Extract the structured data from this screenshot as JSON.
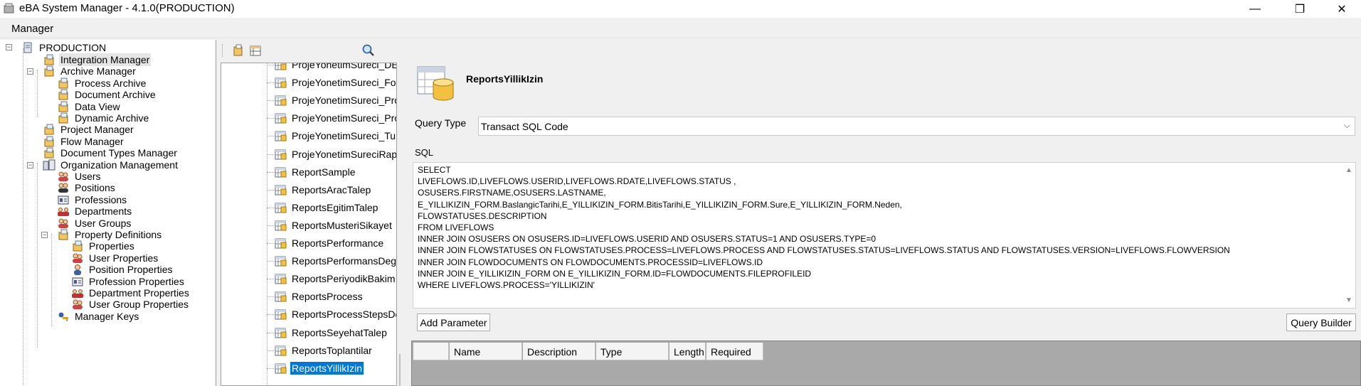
{
  "window": {
    "title": "eBA System Manager - 4.1.0(PRODUCTION)",
    "minimize": "—",
    "restore": "❐",
    "close": "✕"
  },
  "menu": {
    "items": [
      "Manager"
    ]
  },
  "tree": {
    "root": "PRODUCTION",
    "items": [
      {
        "label": "Integration Manager",
        "icon": "box-icon"
      },
      {
        "label": "Archive Manager",
        "icon": "box-icon"
      },
      {
        "label": "Process Archive",
        "icon": "box-icon"
      },
      {
        "label": "Document Archive",
        "icon": "box-icon"
      },
      {
        "label": "Data View",
        "icon": "box-icon"
      },
      {
        "label": "Dynamic Archive",
        "icon": "box-icon"
      },
      {
        "label": "Project Manager",
        "icon": "box-icon"
      },
      {
        "label": "Flow Manager",
        "icon": "box-icon"
      },
      {
        "label": "Document Types Manager",
        "icon": "box-icon"
      },
      {
        "label": "Organization Management",
        "icon": "org-icon"
      },
      {
        "label": "Users",
        "icon": "users-icon"
      },
      {
        "label": "Positions",
        "icon": "positions-icon"
      },
      {
        "label": "Professions",
        "icon": "profession-icon"
      },
      {
        "label": "Departments",
        "icon": "department-icon"
      },
      {
        "label": "User Groups",
        "icon": "users-icon"
      },
      {
        "label": "Property Definitions",
        "icon": "box-icon"
      },
      {
        "label": "Properties",
        "icon": "box-icon"
      },
      {
        "label": "User Properties",
        "icon": "users-icon"
      },
      {
        "label": "Position Properties",
        "icon": "user-icon"
      },
      {
        "label": "Profession Properties",
        "icon": "profession-icon"
      },
      {
        "label": "Department Properties",
        "icon": "department-icon"
      },
      {
        "label": "User Group Properties",
        "icon": "users-icon"
      },
      {
        "label": "Manager Keys",
        "icon": "key-icon"
      }
    ]
  },
  "report_list": {
    "items": [
      "ProjeYonetimSureci_DE",
      "ProjeYonetimSureci_Fo",
      "ProjeYonetimSureci_Pro",
      "ProjeYonetimSureci_Pro",
      "ProjeYonetimSureci_Tu",
      "ProjeYonetimSureciRap",
      "ReportSample",
      "ReportsAracTalep",
      "ReportsEgitimTalep",
      "ReportsMusteriSikayet",
      "ReportsPerformance",
      "ReportsPerformansDeg",
      "ReportsPeriyodikBakim",
      "ReportsProcess",
      "ReportsProcessStepsDe",
      "ReportsSeyehatTalep",
      "ReportsToplantilar",
      "ReportsYillikIzin"
    ],
    "selected": "ReportsYillikIzin"
  },
  "detail": {
    "report_name": "ReportsYillikIzin",
    "query_type_label": "Query Type",
    "query_type_value": "Transact SQL Code",
    "sql_label": "SQL",
    "sql_text": "SELECT\nLIVEFLOWS.ID,LIVEFLOWS.USERID,LIVEFLOWS.RDATE,LIVEFLOWS.STATUS ,\nOSUSERS.FIRSTNAME,OSUSERS.LASTNAME,\nE_YILLIKIZIN_FORM.BaslangicTarihi,E_YILLIKIZIN_FORM.BitisTarihi,E_YILLIKIZIN_FORM.Sure,E_YILLIKIZIN_FORM.Neden,\nFLOWSTATUSES.DESCRIPTION\nFROM LIVEFLOWS\nINNER JOIN OSUSERS ON OSUSERS.ID=LIVEFLOWS.USERID AND OSUSERS.STATUS=1 AND OSUSERS.TYPE=0\nINNER JOIN FLOWSTATUSES ON FLOWSTATUSES.PROCESS=LIVEFLOWS.PROCESS AND FLOWSTATUSES.STATUS=LIVEFLOWS.STATUS AND FLOWSTATUSES.VERSION=LIVEFLOWS.FLOWVERSION\nINNER JOIN FLOWDOCUMENTS ON FLOWDOCUMENTS.PROCESSID=LIVEFLOWS.ID\nINNER JOIN E_YILLIKIZIN_FORM ON E_YILLIKIZIN_FORM.ID=FLOWDOCUMENTS.FILEPROFILEID\nWHERE LIVEFLOWS.PROCESS='YILLIKIZIN'",
    "add_parameter": "Add Parameter",
    "query_builder": "Query Builder",
    "columns": [
      "Name",
      "Description",
      "Type",
      "Length",
      "Required"
    ]
  },
  "colors": {
    "selection": "#0078d7",
    "grid_bg": "#a9a9a9"
  }
}
